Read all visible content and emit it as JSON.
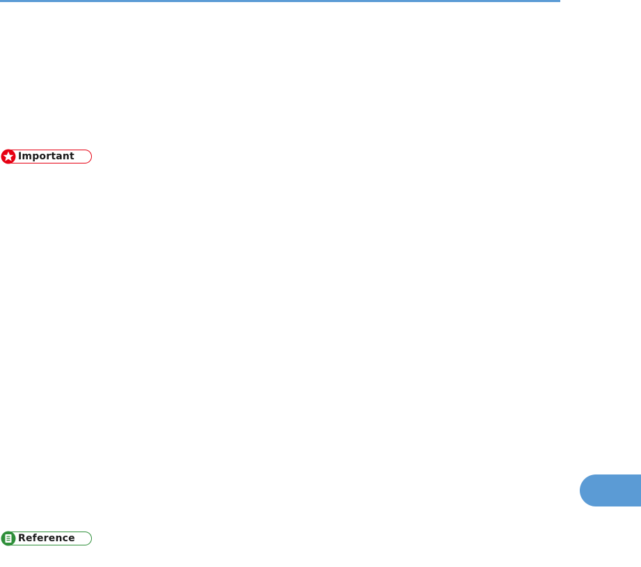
{
  "colors": {
    "accent": "#5b9bd5",
    "important": "#e60012",
    "reference": "#2f8f3a"
  },
  "callouts": {
    "important": {
      "label": "Important",
      "icon": "star-icon"
    },
    "reference": {
      "label": "Reference",
      "icon": "document-icon"
    }
  },
  "chapter_tab": {
    "icon": "chapter-tab"
  }
}
